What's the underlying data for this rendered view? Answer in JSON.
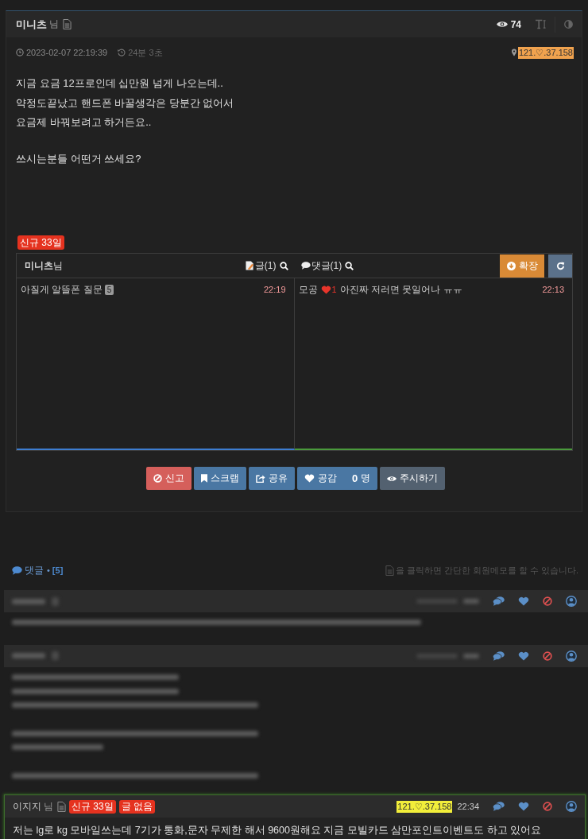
{
  "post": {
    "author": "미니츠",
    "honorific": "님",
    "views": "74",
    "date": "2023-02-07 22:19:39",
    "elapsed": "24분 3초",
    "ip": "121.♡.37.158",
    "paragraphs": [
      "지금 요금 12프로인데 십만원 넘게 나오는데..\n약정도끝났고 핸드폰 바꿀생각은 당분간 없어서\n요금제 바꿔보려고 하거든요..",
      "쓰시는분들 어떤거 쓰세요?"
    ],
    "member_badge": "신규 33일"
  },
  "member_panel": {
    "name": "**미니츠**님",
    "posts_link": "글(1)",
    "comments_link": "댓글(1)",
    "expand_button": "확장",
    "posts": [
      {
        "title": "아질게 알뜰폰 질문",
        "comment_count": "5",
        "time": "22:19"
      }
    ],
    "comments": [
      {
        "board": "모공",
        "likes": "1",
        "text": "아진짜 저러면 못일어나 ㅠㅠ",
        "time": "22:13"
      }
    ]
  },
  "actions": [
    {
      "kind": "report",
      "label": "신고"
    },
    {
      "kind": "scrap",
      "label": "스크랩"
    },
    {
      "kind": "share",
      "label": "공유"
    },
    {
      "kind": "like",
      "label": "공감",
      "count": "0",
      "unit": "명"
    },
    {
      "kind": "watch",
      "label": "주시하기"
    }
  ],
  "comments": {
    "title": "댓글",
    "separator": "•",
    "count": "[5]",
    "memo_hint": "을 클릭하면 간단한 회원메모를 할 수 있습니다.",
    "items": [
      {
        "kind": "blurred",
        "lines": [
          {
            "kind": "full"
          }
        ]
      },
      {
        "kind": "blurred",
        "lines": [
          {
            "kind": "medium"
          },
          {
            "kind": "medium"
          },
          {
            "kind": "long"
          },
          {
            "kind": "blank"
          },
          {
            "kind": "long"
          },
          {
            "kind": "short"
          },
          {
            "kind": "blank"
          },
          {
            "kind": "long"
          }
        ]
      },
      {
        "kind": "visible",
        "author": "이지지",
        "honorific": "님",
        "badges": [
          "신규 33일",
          "글 없음"
        ],
        "ip": "121.♡.37.158",
        "time": "22:34",
        "body": "저는 lg로 kg 모바일쓰는데 7기가 통화,문자 무제한 해서 9600원해요 지금 모빌카드 삼만포인트이벤트도 하고 있어요"
      }
    ]
  }
}
